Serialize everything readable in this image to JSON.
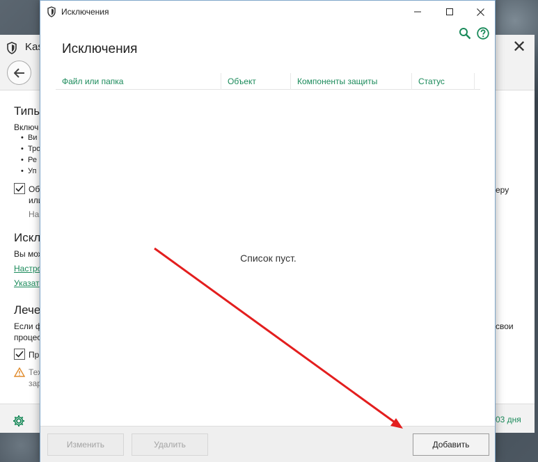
{
  "background_window": {
    "title": "Kas",
    "sections": {
      "threats_heading": "Типы",
      "threats_text": "Включ",
      "bullets": [
        "Ви",
        "Тро",
        "Ре",
        "Уп"
      ],
      "checkbox1_text": "Об",
      "checkbox1_line2": "или",
      "checkbox1_sub": "На",
      "exclusions_heading": "Искл",
      "exclusions_text": "Вы мож",
      "link1": "Настро",
      "link2": "Указат",
      "treatment_heading": "Лече",
      "treatment_text1": "Если ф",
      "treatment_text2": "процес",
      "checkbox2_text": "Пр",
      "warning_text1": "Тех",
      "warning_text2": "зар"
    },
    "right_fragments": {
      "frag1": "еру",
      "frag2": "свои"
    },
    "footer": {
      "days_left": "03 дня"
    }
  },
  "dialog": {
    "title": "Исключения",
    "heading": "Исключения",
    "columns": [
      "Файл или папка",
      "Объект",
      "Компоненты защиты",
      "Статус"
    ],
    "empty_message": "Список пуст.",
    "buttons": {
      "edit": "Изменить",
      "delete": "Удалить",
      "add": "Добавить"
    }
  },
  "colors": {
    "accent": "#1a8a5a",
    "annotation_arrow": "#e31e1e"
  }
}
